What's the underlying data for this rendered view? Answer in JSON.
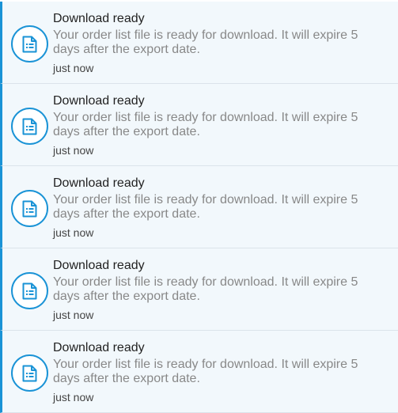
{
  "colors": {
    "accent": "#1a93d6",
    "background": "#f2f8fc",
    "title": "#222222",
    "message": "#888888",
    "time": "#444444"
  },
  "notifications": [
    {
      "icon": "document-icon",
      "title": "Download ready",
      "message": "Your order list file is ready for download. It will expire 5 days after the export date.",
      "time": "just now"
    },
    {
      "icon": "document-icon",
      "title": "Download ready",
      "message": "Your order list file is ready for download. It will expire 5 days after the export date.",
      "time": "just now"
    },
    {
      "icon": "document-icon",
      "title": "Download ready",
      "message": "Your order list file is ready for download. It will expire 5 days after the export date.",
      "time": "just now"
    },
    {
      "icon": "document-icon",
      "title": "Download ready",
      "message": "Your order list file is ready for download. It will expire 5 days after the export date.",
      "time": "just now"
    },
    {
      "icon": "document-icon",
      "title": "Download ready",
      "message": "Your order list file is ready for download. It will expire 5 days after the export date.",
      "time": "just now"
    }
  ]
}
